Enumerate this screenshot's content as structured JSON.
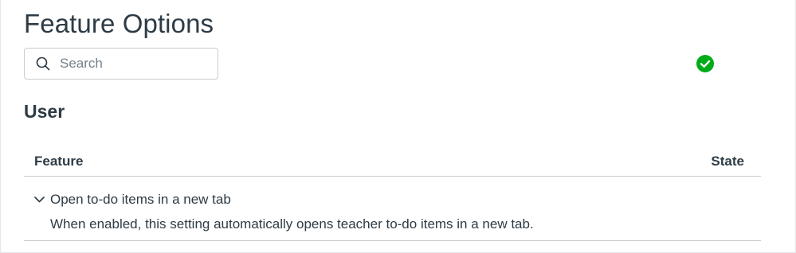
{
  "page": {
    "title": "Feature Options"
  },
  "search": {
    "placeholder": "Search",
    "value": ""
  },
  "section": {
    "heading": "User"
  },
  "table": {
    "columns": {
      "feature": "Feature",
      "state": "State"
    },
    "rows": [
      {
        "name": "Open to-do items in a new tab",
        "description": "When enabled, this setting automatically opens teacher to-do items in a new tab.",
        "state": "enabled",
        "expand_icon": "chevron-down-icon",
        "state_icon": "check-circle-icon"
      }
    ]
  },
  "colors": {
    "text": "#2d3b45",
    "placeholder": "#73818c",
    "border": "#c7cdd1",
    "enabled": "#00ac18"
  }
}
